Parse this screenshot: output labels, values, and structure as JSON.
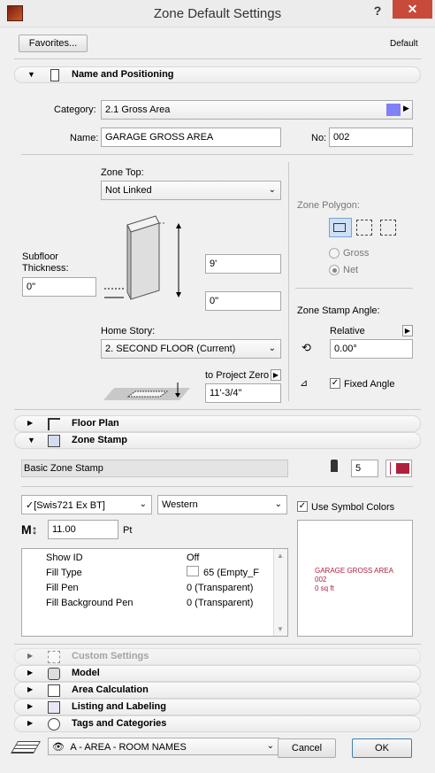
{
  "window": {
    "title": "Zone Default Settings",
    "help": "?",
    "close": "✕"
  },
  "top": {
    "favorites_label": "Favorites...",
    "default_label": "Default"
  },
  "sections": {
    "name_positioning": "Name and Positioning",
    "floor_plan": "Floor Plan",
    "zone_stamp": "Zone Stamp",
    "custom_settings": "Custom Settings",
    "model": "Model",
    "area_calculation": "Area Calculation",
    "listing_labeling": "Listing and Labeling",
    "tags_categories": "Tags and Categories"
  },
  "name_pos": {
    "category_label": "Category:",
    "category_value": "2.1  Gross Area",
    "category_color": "#8080f8",
    "name_label": "Name:",
    "name_value": "GARAGE GROSS AREA",
    "no_label": "No:",
    "no_value": "002"
  },
  "geometry": {
    "zone_top_label": "Zone Top:",
    "zone_top_value": "Not Linked",
    "height_value": "9'",
    "offset_value": "0\"",
    "subfloor_label": "Subfloor Thickness:",
    "subfloor_value": "0\"",
    "home_story_label": "Home Story:",
    "home_story_value": "2. SECOND FLOOR (Current)",
    "to_project_zero_label": "to Project Zero",
    "project_zero_value": "11'-3/4\""
  },
  "polygon": {
    "label": "Zone Polygon:",
    "gross_label": "Gross",
    "net_label": "Net",
    "stamp_angle_label": "Zone Stamp Angle:",
    "relative_label": "Relative",
    "angle_value": "0.00°",
    "fixed_angle_label": "Fixed Angle"
  },
  "stamp": {
    "name": "Basic Zone Stamp",
    "pen_value": "5",
    "pen_color": "#b0203c",
    "font_value": "✓[Swis721 Ex BT]",
    "script_value": "Western",
    "use_symbol_colors_label": "Use Symbol Colors",
    "size_value": "11.00",
    "size_unit": "Pt",
    "params": [
      {
        "name": "Show ID",
        "value": "Off"
      },
      {
        "name": "Fill Type",
        "value": "65 (Empty_F"
      },
      {
        "name": "Fill Pen",
        "value": "0 (Transparent)"
      },
      {
        "name": "Fill Background Pen",
        "value": "0 (Transparent)"
      }
    ],
    "preview": {
      "line1": "GARAGE GROSS AREA",
      "line2": "002",
      "line3": "0 sq ft",
      "color": "#b0203c"
    }
  },
  "bottom": {
    "layer_value": "A - AREA - ROOM NAMES",
    "cancel_label": "Cancel",
    "ok_label": "OK"
  }
}
